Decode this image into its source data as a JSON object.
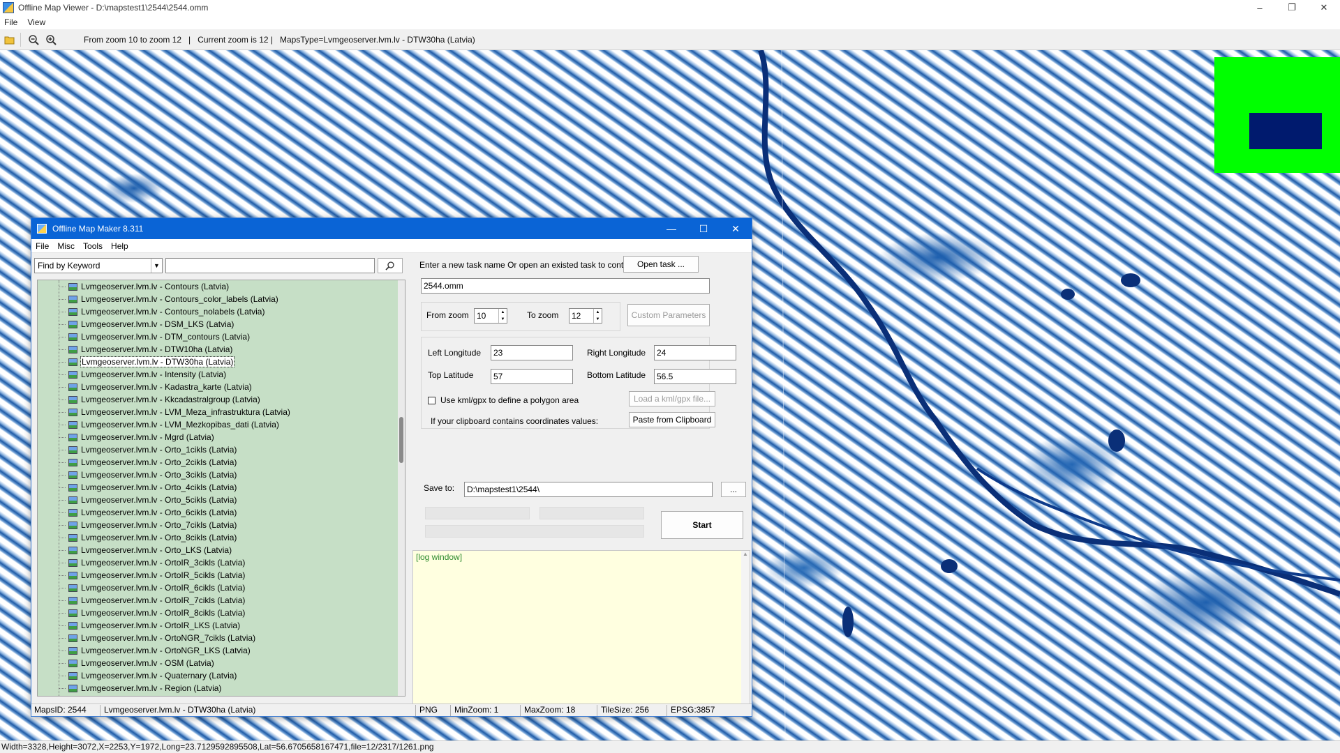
{
  "window": {
    "title": "Offline Map Viewer - D:\\mapstest1\\2544\\2544.omm",
    "controls": [
      "–",
      "❐",
      "✕"
    ]
  },
  "menu": [
    "File",
    "View"
  ],
  "toolbar": {
    "info": "From zoom 10 to zoom 12   |   Current zoom is 12 |   MapsType=Lvmgeoserver.lvm.lv - DTW30ha (Latvia)"
  },
  "colors": {
    "overview_bg": "#00ff00",
    "overview_viewport": "#001a6e",
    "dialog_title": "#0a64d6",
    "tree_bg": "#c6dfc6",
    "log_bg": "#ffffe0"
  },
  "statusbar": {
    "text": "Width=3328,Height=3072,X=2253,Y=1972,Long=23.7129592895508,Lat=56.6705658167471,file=12/2317/1261.png"
  },
  "dialog": {
    "title": "Offline Map Maker 8.311",
    "controls": [
      "—",
      "☐",
      "✕"
    ],
    "menu": [
      "File",
      "Misc",
      "Tools",
      "Help"
    ],
    "search": {
      "mode": "Find by Keyword",
      "value": ""
    },
    "tree_items": [
      "Lvmgeoserver.lvm.lv - Contours (Latvia)",
      "Lvmgeoserver.lvm.lv - Contours_color_labels (Latvia)",
      "Lvmgeoserver.lvm.lv - Contours_nolabels (Latvia)",
      "Lvmgeoserver.lvm.lv - DSM_LKS (Latvia)",
      "Lvmgeoserver.lvm.lv - DTM_contours (Latvia)",
      "Lvmgeoserver.lvm.lv - DTW10ha (Latvia)",
      "Lvmgeoserver.lvm.lv - DTW30ha (Latvia)",
      "Lvmgeoserver.lvm.lv - Intensity (Latvia)",
      "Lvmgeoserver.lvm.lv - Kadastra_karte (Latvia)",
      "Lvmgeoserver.lvm.lv - Kkcadastralgroup (Latvia)",
      "Lvmgeoserver.lvm.lv - LVM_Meza_infrastruktura (Latvia)",
      "Lvmgeoserver.lvm.lv - LVM_Mezkopibas_dati (Latvia)",
      "Lvmgeoserver.lvm.lv - Mgrd (Latvia)",
      "Lvmgeoserver.lvm.lv - Orto_1cikls (Latvia)",
      "Lvmgeoserver.lvm.lv - Orto_2cikls (Latvia)",
      "Lvmgeoserver.lvm.lv - Orto_3cikls (Latvia)",
      "Lvmgeoserver.lvm.lv - Orto_4cikls (Latvia)",
      "Lvmgeoserver.lvm.lv - Orto_5cikls (Latvia)",
      "Lvmgeoserver.lvm.lv - Orto_6cikls (Latvia)",
      "Lvmgeoserver.lvm.lv - Orto_7cikls (Latvia)",
      "Lvmgeoserver.lvm.lv - Orto_8cikls (Latvia)",
      "Lvmgeoserver.lvm.lv - Orto_LKS (Latvia)",
      "Lvmgeoserver.lvm.lv - OrtoIR_3cikls (Latvia)",
      "Lvmgeoserver.lvm.lv - OrtoIR_5cikls (Latvia)",
      "Lvmgeoserver.lvm.lv - OrtoIR_6cikls (Latvia)",
      "Lvmgeoserver.lvm.lv - OrtoIR_7cikls (Latvia)",
      "Lvmgeoserver.lvm.lv - OrtoIR_8cikls (Latvia)",
      "Lvmgeoserver.lvm.lv - OrtoIR_LKS (Latvia)",
      "Lvmgeoserver.lvm.lv - OrtoNGR_7cikls (Latvia)",
      "Lvmgeoserver.lvm.lv - OrtoNGR_LKS (Latvia)",
      "Lvmgeoserver.lvm.lv - OSM (Latvia)",
      "Lvmgeoserver.lvm.lv - Quaternary (Latvia)",
      "Lvmgeoserver.lvm.lv - Region (Latvia)"
    ],
    "selected_item": "Lvmgeoserver.lvm.lv - DTW30ha (Latvia)",
    "task_prompt": "Enter a new task name Or open an existed task to continue:",
    "open_task_label": "Open task ...",
    "task_name": "2544.omm",
    "from_zoom_label": "From zoom",
    "from_zoom": "10",
    "to_zoom_label": "To zoom",
    "to_zoom": "12",
    "custom_params_label": "Custom Parameters",
    "left_lon_label": "Left Longitude",
    "left_lon": "23",
    "right_lon_label": "Right Longitude",
    "right_lon": "24",
    "top_lat_label": "Top Latitude",
    "top_lat": "57",
    "bottom_lat_label": "Bottom Latitude",
    "bottom_lat": "56.5",
    "kml_label": "Use kml/gpx to define a polygon area",
    "load_kml_label": "Load a kml/gpx file...",
    "clipboard_prompt": "If your clipboard contains coordinates values:",
    "paste_label": "Paste from Clipboard",
    "save_to_label": "Save to:",
    "save_to": "D:\\mapstest1\\2544\\",
    "browse_label": "...",
    "start_label": "Start",
    "log_text": "[log window]",
    "status": {
      "maps_id": "MapsID: 2544",
      "maps_type": "Lvmgeoserver.lvm.lv - DTW30ha (Latvia)",
      "format": "PNG",
      "min_zoom": "MinZoom: 1",
      "max_zoom": "MaxZoom: 18",
      "tile_size": "TileSize: 256",
      "epsg": "EPSG:3857"
    }
  }
}
